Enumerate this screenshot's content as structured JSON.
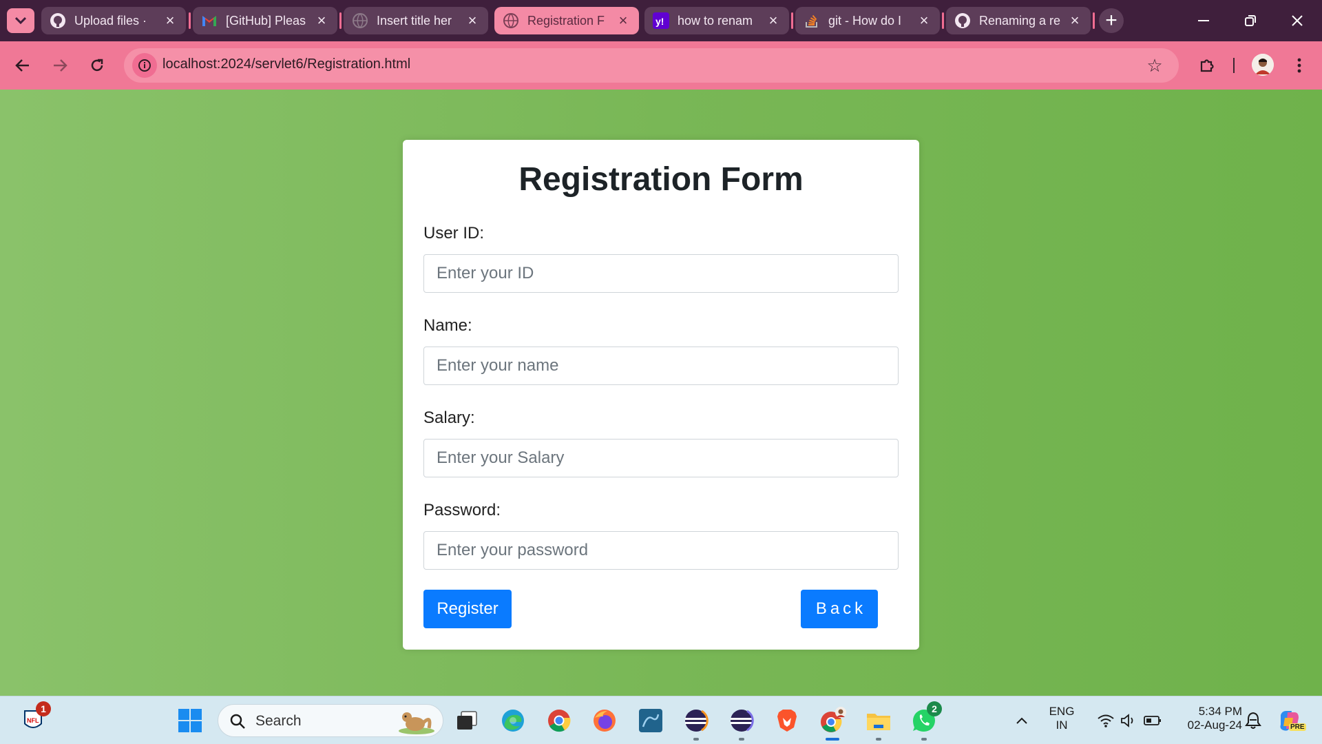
{
  "browser": {
    "tabs": [
      {
        "title": "Upload files · ",
        "favicon": "github-icon",
        "active": false
      },
      {
        "title": "[GitHub] Pleas",
        "favicon": "gmail-icon",
        "active": false
      },
      {
        "title": "Insert title her",
        "favicon": "globe-icon",
        "active": false
      },
      {
        "title": "Registration F",
        "favicon": "globe-icon",
        "active": true
      },
      {
        "title": "how to renam",
        "favicon": "yahoo-icon",
        "active": false
      },
      {
        "title": "git - How do I",
        "favicon": "stackoverflow-icon",
        "active": false
      },
      {
        "title": "Renaming a re",
        "favicon": "github-icon",
        "active": false
      }
    ],
    "url": "localhost:2024/servlet6/Registration.html"
  },
  "form": {
    "title": "Registration Form",
    "fields": [
      {
        "label": "User ID:",
        "placeholder": "Enter your ID"
      },
      {
        "label": "Name:",
        "placeholder": "Enter your name"
      },
      {
        "label": "Salary:",
        "placeholder": "Enter your Salary"
      },
      {
        "label": "Password:",
        "placeholder": "Enter your password"
      }
    ],
    "register_label": "Register",
    "back_label": "Back"
  },
  "taskbar": {
    "search_label": "Search",
    "nfl_badge": "1",
    "whatsapp_badge": "2",
    "language": "ENG",
    "region": "IN",
    "time": "5:34 PM",
    "date": "02-Aug-24",
    "copilot_label": "PRE"
  },
  "colors": {
    "page_background": "#7cb95a",
    "button_primary": "#0a7bff",
    "tab_active": "#f48aa5",
    "toolbar": "#f07896"
  }
}
